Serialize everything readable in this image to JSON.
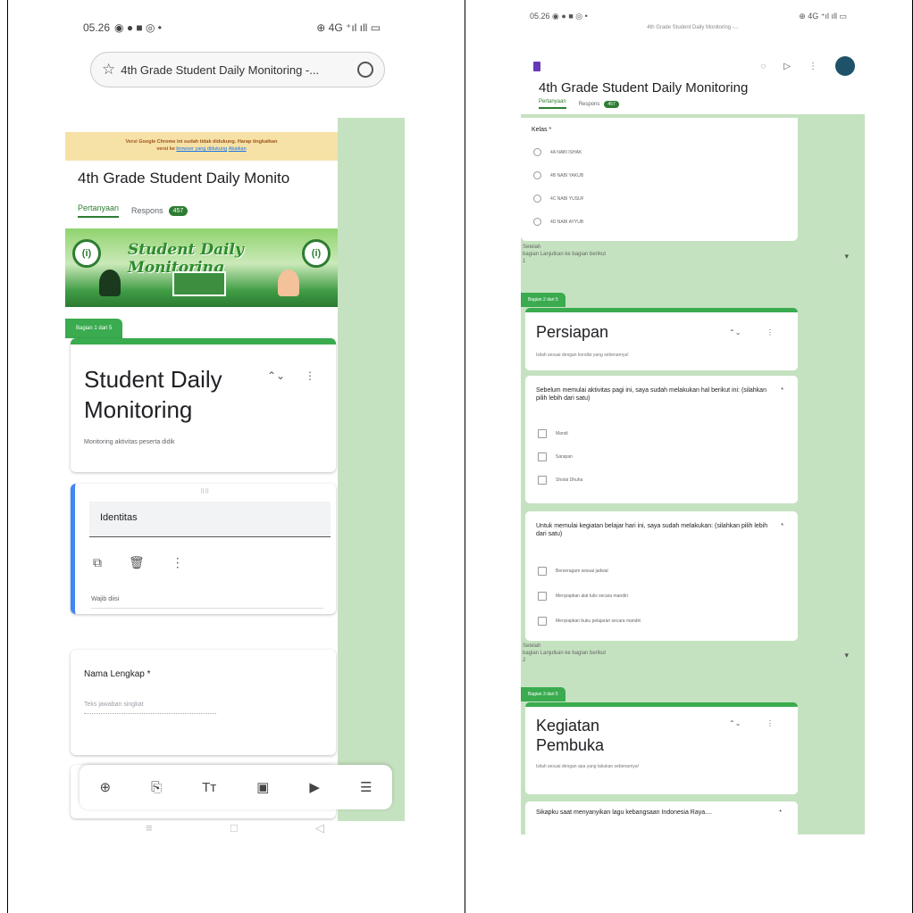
{
  "left": {
    "status": {
      "time": "05.26",
      "icons_left": "◉ ● ■ ◎ •",
      "icons_right": "⊕ 4G ⁺ıl ıll ▭"
    },
    "url": {
      "text": "4th Grade Student Daily Monitoring -..."
    },
    "warning": {
      "line1": "Versi Google Chrome ini sudah tidak didukung. Harap tingkatkan",
      "line2a": "versi ke",
      "link": "browser yang didukung",
      "dismiss": "Abaikan"
    },
    "form_title": "4th Grade Student Daily Monito",
    "tabs": {
      "questions": "Pertanyaan",
      "responses": "Respons",
      "count": "457"
    },
    "banner_text": "Student Daily Monitoring",
    "section_label": "Bagian 1 dari 5",
    "header_card": {
      "title": "Student Daily Monitoring",
      "description": "Monitoring aktivitas peserta didik"
    },
    "identity_card": {
      "field": "Identitas",
      "required": "Wajib diisi"
    },
    "name_card": {
      "question": "Nama Lengkap *",
      "placeholder": "Teks jawaban singkat"
    },
    "toolbar": [
      "⊕",
      "⎘",
      "Tт",
      "▣",
      "▶",
      "☰"
    ],
    "nav": [
      "≡",
      "□",
      "◁"
    ]
  },
  "right": {
    "status": {
      "time": "05.26",
      "icons_left": "◉ ● ■ ◎ •",
      "icons_right": "⊕ 4G ⁺ıl ıll ▭"
    },
    "url": "4th Grade Student Daily Monitoring -...",
    "title": "4th Grade Student Daily Monitoring",
    "tabs": {
      "questions": "Pertanyaan",
      "responses": "Respons",
      "count": "457"
    },
    "kelas_card": {
      "question": "Kelas *",
      "options": [
        "4A NABI ISHAK",
        "4B NABI YAKUB",
        "4C NABI YUSUF",
        "4D NABI AYYUB"
      ]
    },
    "nav1": {
      "line1": "Setelah",
      "line2": "bagian   Lanjutkan ke bagian berikut",
      "line3": "1"
    },
    "section2": "Bagian 2 dari 5",
    "persiapan": {
      "title": "Persiapan",
      "description": "Isilah sesuai dengan kondisi yang sebenarnya!"
    },
    "q1": {
      "text": "Sebelum memulai aktivitas pagi ini, saya sudah melakukan hal berikut ini: (silahkan pilih lebih dari satu)",
      "options": [
        "Mandi",
        "Sarapan",
        "Sholat Dhuha"
      ]
    },
    "q2": {
      "text": "Untuk memulai kegiatan belajar hari ini, saya sudah melakukan: (silahkan pilih lebih dari satu)",
      "options": [
        "Berseragam sesuai jadwal",
        "Menyiapkan alat tulis secara mandiri",
        "Menyiapkan buku pelajaran secara mandiri"
      ]
    },
    "nav2": {
      "line1": "Setelah",
      "line2": "bagian   Lanjutkan ke bagian berikut",
      "line3": "2"
    },
    "section3": "Bagian 3 dari 5",
    "pembuka": {
      "title": "Kegiatan Pembuka",
      "description": "Isilah sesuai dengan apa yang lakukan sebenarnya!"
    },
    "q3": {
      "text": "Sikapku saat menyanyikan lagu kebangsaan Indonesia Raya...."
    }
  }
}
